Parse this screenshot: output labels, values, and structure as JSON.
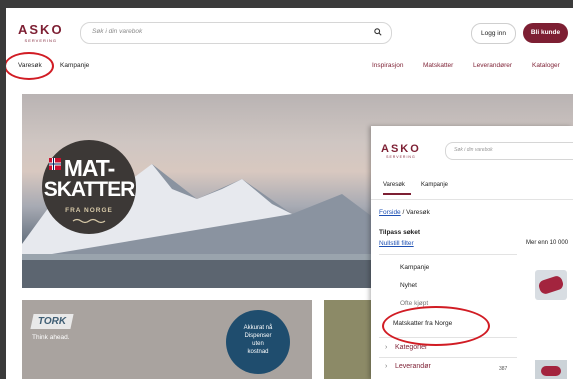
{
  "header": {
    "logo": "ASKO",
    "logo_sub": "SERVERING",
    "search_placeholder": "Søk i din varebok",
    "login_label": "Logg inn",
    "join_label": "Bli kunde"
  },
  "nav": {
    "left": [
      "Varesøk",
      "Kampanje"
    ],
    "right": [
      "Inspirasjon",
      "Matskatter",
      "Leverandører",
      "Kataloger"
    ]
  },
  "hero": {
    "line1": "MAT-",
    "line2": "SKATTER",
    "line3": "FRA NORGE"
  },
  "tiles": {
    "tork_logo": "TORK",
    "tork_tagline": "Think ahead.",
    "dispenser_lines": [
      "Akkurat nå",
      "Dispenser",
      "uten",
      "kostnad"
    ]
  },
  "overlay": {
    "logo": "ASKO",
    "logo_sub": "SERVERING",
    "search_placeholder": "Søk i din varebok",
    "tabs": [
      "Varesøk",
      "Kampanje"
    ],
    "breadcrumb_home": "Forside",
    "breadcrumb_sep": " / ",
    "breadcrumb_current": "Varesøk",
    "filter_heading": "Tilpass søket",
    "reset_filter": "Nullstill filter",
    "result_count": "Mer enn 10 000",
    "filter_items": [
      "Kampanje",
      "Nyhet",
      "Ofte kjøpt",
      "Matskatter fra Norge"
    ],
    "categories": [
      "Kategorier",
      "Leverandør"
    ],
    "leverandor_count": "387"
  },
  "colors": {
    "brand": "#7d1f33",
    "highlight_circle": "#d11c24",
    "link": "#1e50b3"
  }
}
